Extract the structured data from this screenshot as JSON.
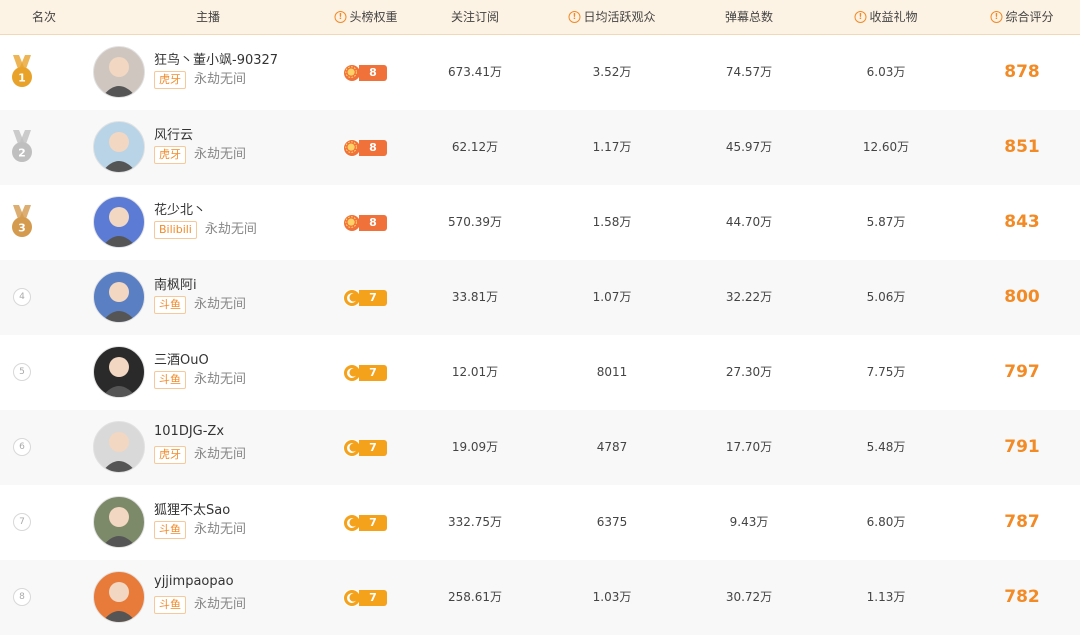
{
  "columns": {
    "rank": "名次",
    "streamer": "主播",
    "weight": "头榜权重",
    "followers": "关注订阅",
    "daily_viewers": "日均活跃观众",
    "danmaku": "弹幕总数",
    "gifts": "收益礼物",
    "score": "综合评分"
  },
  "colors": {
    "accent": "#f28a25",
    "header_bg": "#fdf3e4",
    "gold": "#e8a22a",
    "silver": "#bfbfbf",
    "bronze": "#d49a4e"
  },
  "rows": [
    {
      "rank": "1",
      "name": "狂鸟丶董小飒-90327",
      "platform": "虎牙",
      "category": "永劫无间",
      "weight": "8",
      "weight_icon": "sun-icon",
      "followers": "673.41万",
      "daily_viewers": "3.52万",
      "danmaku": "74.57万",
      "gifts": "6.03万",
      "score": "878"
    },
    {
      "rank": "2",
      "name": "风行云",
      "platform": "虎牙",
      "category": "永劫无间",
      "weight": "8",
      "weight_icon": "sun-icon",
      "followers": "62.12万",
      "daily_viewers": "1.17万",
      "danmaku": "45.97万",
      "gifts": "12.60万",
      "score": "851"
    },
    {
      "rank": "3",
      "name": "花少北丶",
      "platform": "Bilibili",
      "category": "永劫无间",
      "weight": "8",
      "weight_icon": "sun-icon",
      "followers": "570.39万",
      "daily_viewers": "1.58万",
      "danmaku": "44.70万",
      "gifts": "5.87万",
      "score": "843"
    },
    {
      "rank": "4",
      "name": "南枫阿i",
      "platform": "斗鱼",
      "category": "永劫无间",
      "weight": "7",
      "weight_icon": "moon-icon",
      "followers": "33.81万",
      "daily_viewers": "1.07万",
      "danmaku": "32.22万",
      "gifts": "5.06万",
      "score": "800"
    },
    {
      "rank": "5",
      "name": "三酒OuO",
      "platform": "斗鱼",
      "category": "永劫无间",
      "weight": "7",
      "weight_icon": "moon-icon",
      "followers": "12.01万",
      "daily_viewers": "8011",
      "danmaku": "27.30万",
      "gifts": "7.75万",
      "score": "797"
    },
    {
      "rank": "6",
      "name": "101DJG-Zx",
      "platform": "虎牙",
      "category": "永劫无间",
      "weight": "7",
      "weight_icon": "moon-icon",
      "followers": "19.09万",
      "daily_viewers": "4787",
      "danmaku": "17.70万",
      "gifts": "5.48万",
      "score": "791"
    },
    {
      "rank": "7",
      "name": "狐狸不太Sao",
      "platform": "斗鱼",
      "category": "永劫无间",
      "weight": "7",
      "weight_icon": "moon-icon",
      "followers": "332.75万",
      "daily_viewers": "6375",
      "danmaku": "9.43万",
      "gifts": "6.80万",
      "score": "787"
    },
    {
      "rank": "8",
      "name": "yjjimpaopao",
      "platform": "斗鱼",
      "category": "永劫无间",
      "weight": "7",
      "weight_icon": "moon-icon",
      "followers": "258.61万",
      "daily_viewers": "1.03万",
      "danmaku": "30.72万",
      "gifts": "1.13万",
      "score": "782"
    }
  ]
}
